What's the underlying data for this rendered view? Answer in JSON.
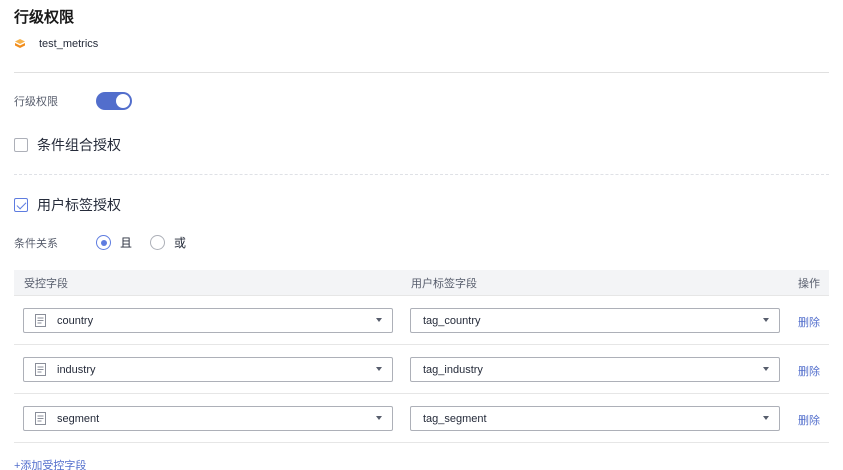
{
  "title": "行级权限",
  "dataset": {
    "name": "test_metrics",
    "icon": "dataset-icon"
  },
  "row_permission": {
    "label": "行级权限",
    "enabled": true
  },
  "condition_combo": {
    "label": "条件组合授权",
    "checked": false
  },
  "user_tag": {
    "label": "用户标签授权",
    "checked": true
  },
  "relation": {
    "label": "条件关系",
    "options": [
      {
        "label": "且",
        "selected": true
      },
      {
        "label": "或",
        "selected": false
      }
    ]
  },
  "table": {
    "headers": [
      "受控字段",
      "用户标签字段",
      "操作"
    ],
    "rows": [
      {
        "field": "country",
        "tag": "tag_country",
        "action": "删除"
      },
      {
        "field": "industry",
        "tag": "tag_industry",
        "action": "删除"
      },
      {
        "field": "segment",
        "tag": "tag_segment",
        "action": "删除"
      }
    ]
  },
  "add_field_label": "+添加受控字段",
  "colors": {
    "accent": "#526ecc",
    "toggle_on": "#526ecc",
    "dataset_icon": "#f5a623"
  }
}
